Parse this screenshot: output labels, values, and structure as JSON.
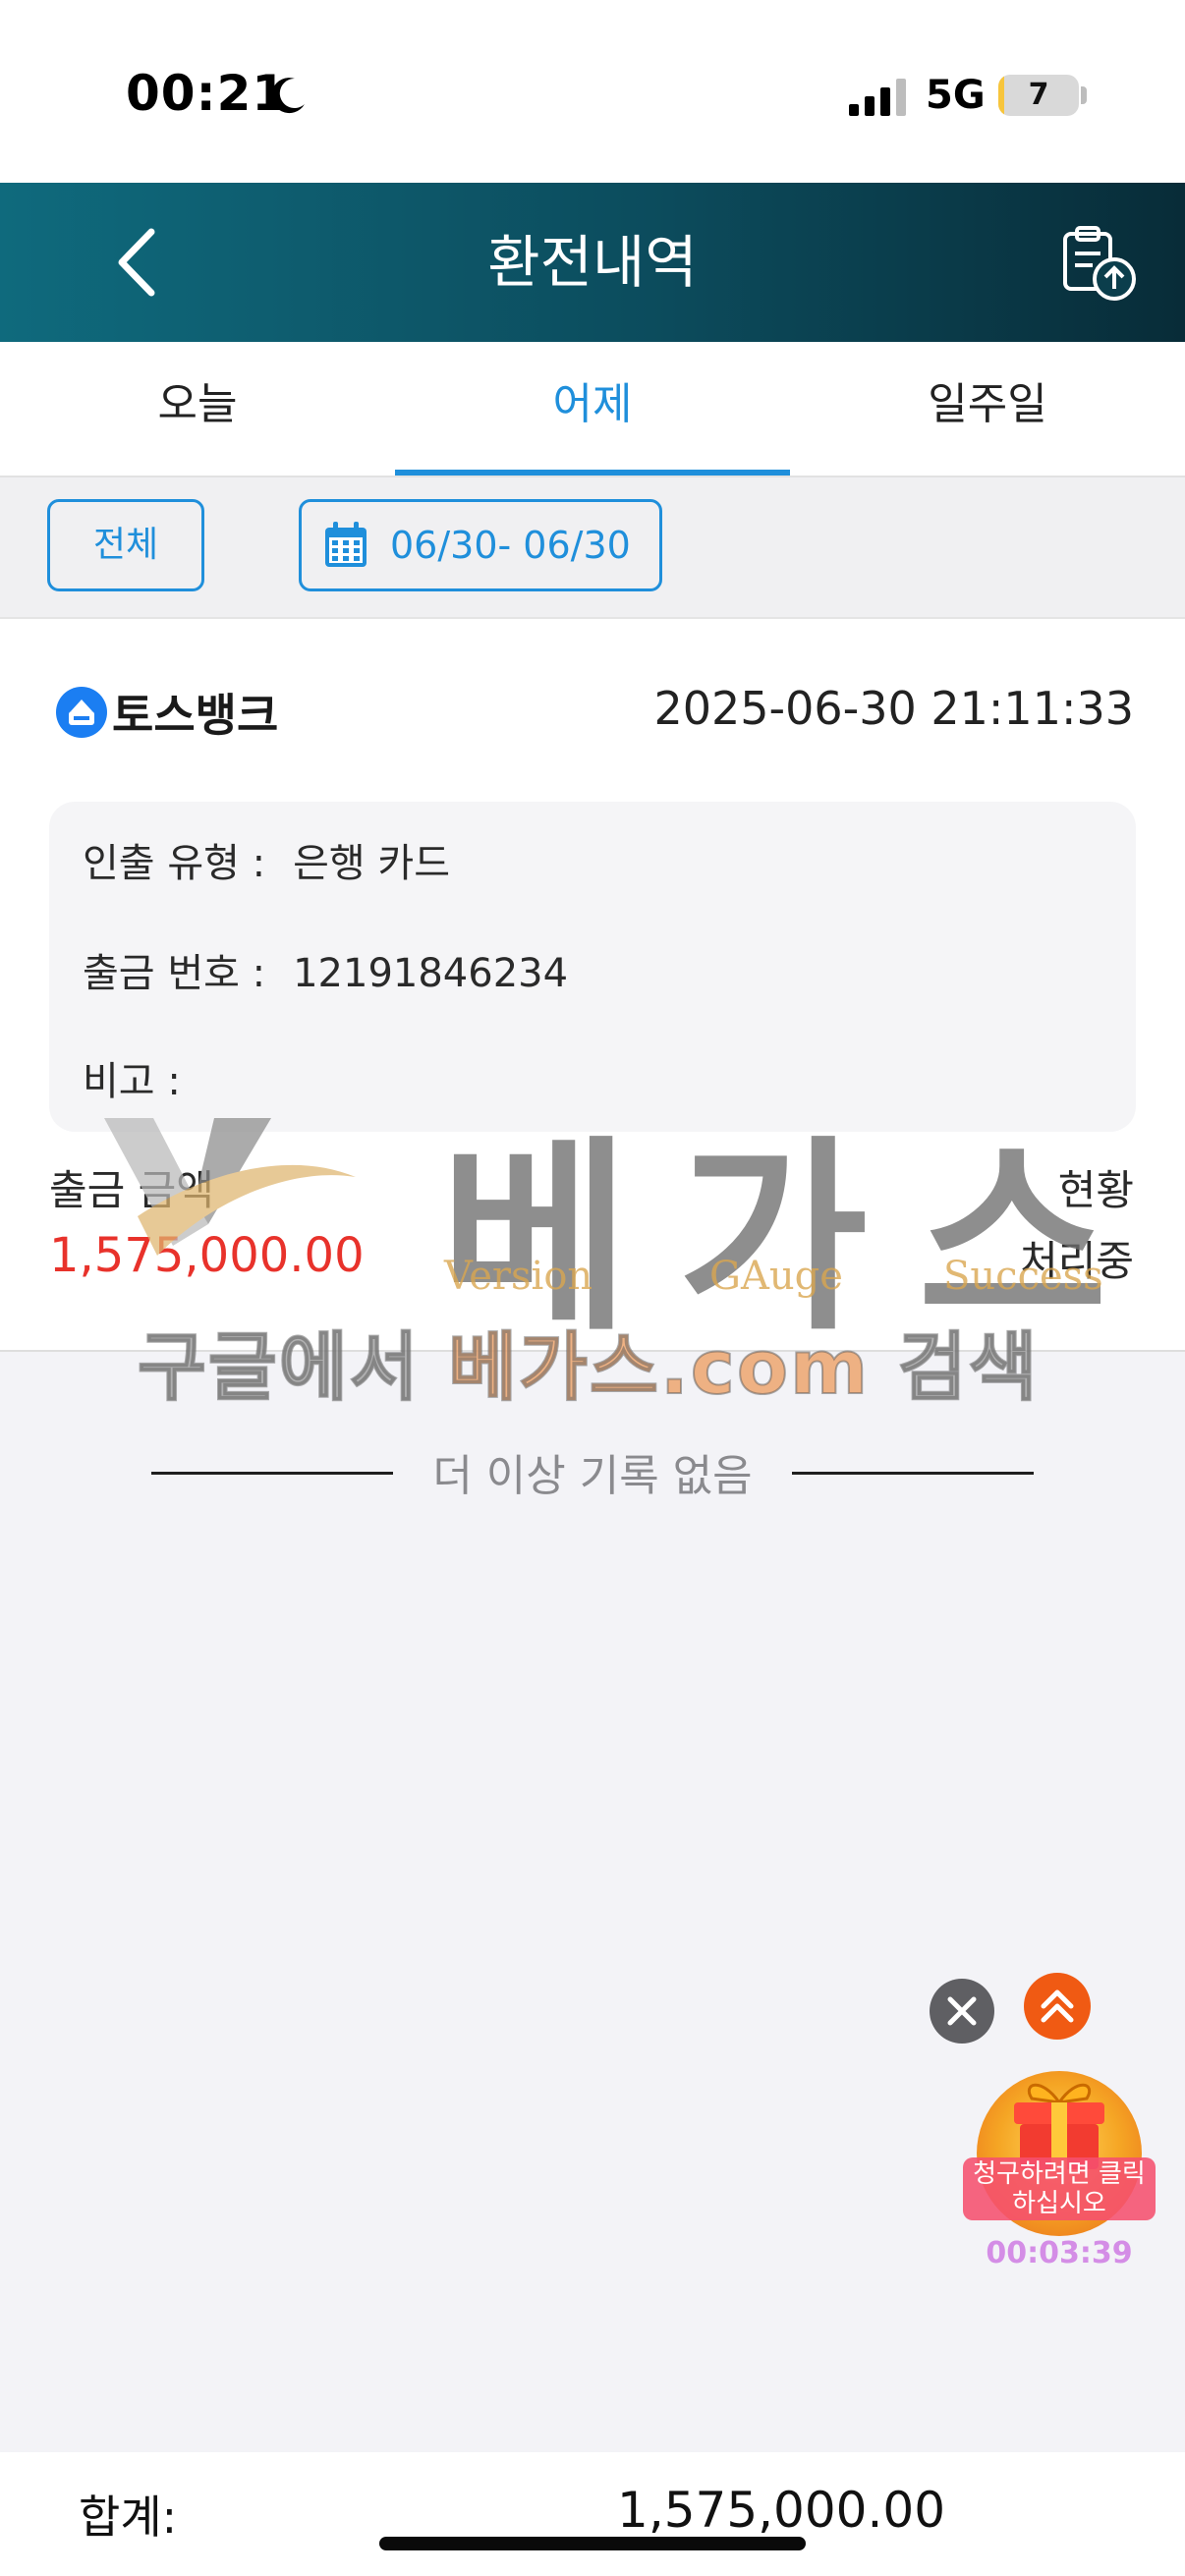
{
  "status_bar": {
    "time": "00:21",
    "network": "5G",
    "battery_level": "7",
    "battery_fraction": 0.07,
    "icons": [
      "moon-icon",
      "signal-icon",
      "battery-icon"
    ]
  },
  "header": {
    "title": "환전내역",
    "back_icon": "chevron-left-icon",
    "export_icon": "clipboard-upload-icon"
  },
  "tabs": [
    {
      "label": "오늘",
      "active": false
    },
    {
      "label": "어제",
      "active": true
    },
    {
      "label": "일주일",
      "active": false
    }
  ],
  "filter": {
    "all_label": "전체",
    "date_range": "06/30- 06/30",
    "calendar_icon": "calendar-icon"
  },
  "record": {
    "bank_name": "토스뱅크",
    "bank_icon": "toss-bank-logo-icon",
    "datetime": "2025-06-30 21:11:33",
    "details": [
      {
        "label": "인출 유형 :",
        "value": "은행 카드"
      },
      {
        "label": "출금 번호 :",
        "value": "12191846234"
      },
      {
        "label": "비고 :",
        "value": ""
      }
    ],
    "amount_label": "출금 금액",
    "amount_value": "1,575,000.00",
    "status_label": "현황",
    "status_value": "처리중"
  },
  "no_more_text": "더 이상 기록 없음",
  "watermark": {
    "chars": [
      "베",
      "가",
      "스"
    ],
    "subwords": [
      "Version",
      "GAuge",
      "Success"
    ],
    "line_prefix": "구글에서 ",
    "line_highlight": "베가스.com",
    "line_suffix": " 검색"
  },
  "floating": {
    "close_icon": "close-icon",
    "up_icon": "double-chevron-up-icon",
    "gift_icon": "gift-box-icon",
    "gift_text": "청구하려면 클릭하십시오",
    "timer": "00:03:39"
  },
  "total": {
    "label": "합계:",
    "value": "1,575,000.00"
  },
  "colors": {
    "accent": "#1f8fdb",
    "header_gradient_start": "#0f6a7d",
    "header_gradient_end": "#082c38",
    "amount": "#e8322b"
  }
}
